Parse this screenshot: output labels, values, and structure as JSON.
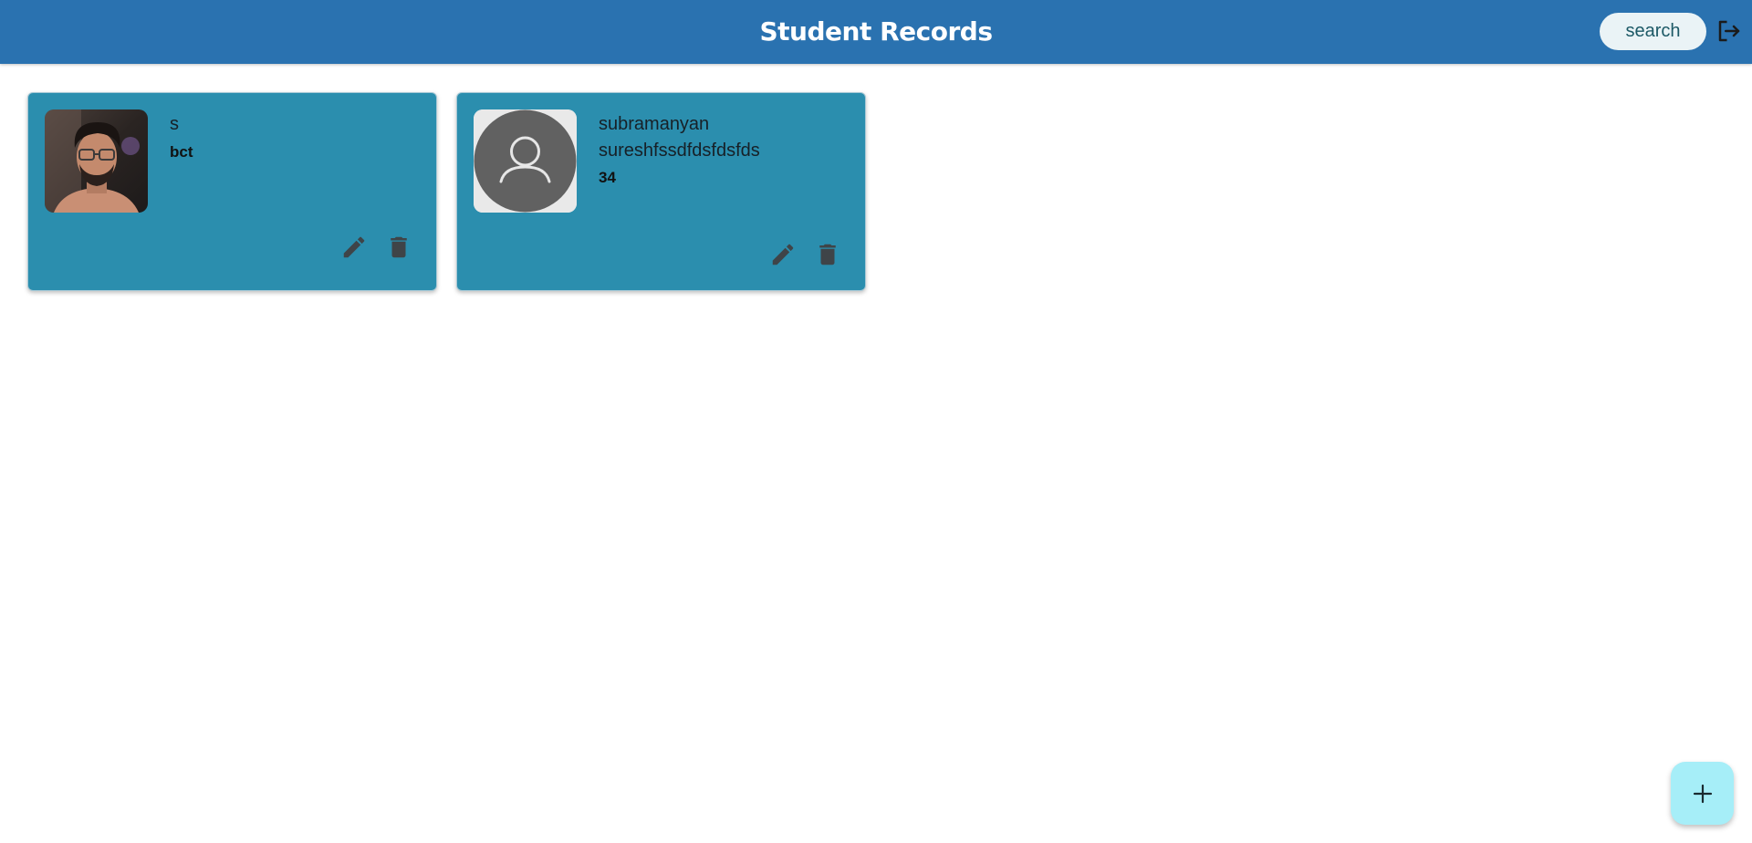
{
  "header": {
    "title": "Student Records",
    "search_label": "search",
    "logout_icon": "logout-icon",
    "background": "#2a72b0"
  },
  "students": [
    {
      "name": "s",
      "detail": "bct",
      "photo": "user-photo",
      "actions": [
        "edit-icon",
        "delete-icon"
      ]
    },
    {
      "name": "subramanyan sureshfssdfdsfdsfds",
      "detail": "34",
      "photo": "default-avatar-icon",
      "actions": [
        "edit-icon",
        "delete-icon"
      ]
    }
  ],
  "fab": {
    "icon": "plus-icon",
    "color": "#a6eef8"
  },
  "colors": {
    "card": "#2b8eae",
    "icon": "#3f4448"
  }
}
